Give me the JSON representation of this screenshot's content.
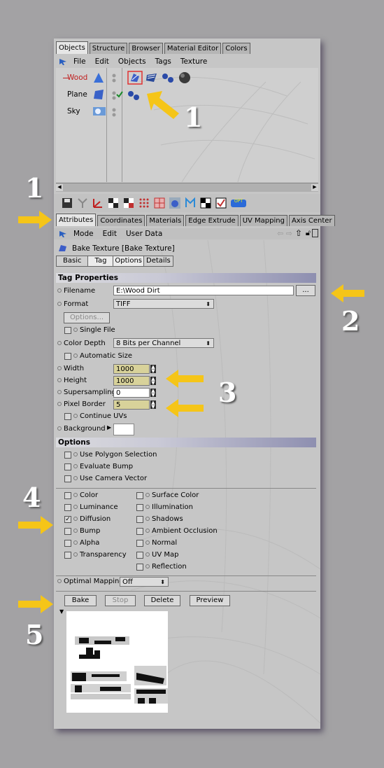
{
  "top_tabs": [
    "Objects",
    "Structure",
    "Browser",
    "Material Editor",
    "Colors"
  ],
  "top_menu": [
    "File",
    "Edit",
    "Objects",
    "Tags",
    "Texture"
  ],
  "objects": [
    {
      "name": "Wood",
      "highlight": true
    },
    {
      "name": "Plane",
      "highlight": false
    },
    {
      "name": "Sky",
      "highlight": false
    }
  ],
  "attr_tabs": [
    "Attributes",
    "Coordinates",
    "Materials",
    "Edge Extrude",
    "UV Mapping",
    "Axis Center"
  ],
  "attr_menu": [
    "Mode",
    "Edit",
    "User Data"
  ],
  "tag_title": "Bake Texture [Bake Texture]",
  "sub_tabs": [
    "Basic",
    "Tag",
    "Options",
    "Details"
  ],
  "tag_properties": {
    "header": "Tag Properties",
    "filename_label": "Filename",
    "filename_value": "E:\\Wood Dirt",
    "browse_label": "...",
    "format_label": "Format",
    "format_value": "TIFF",
    "options_button": "Options...",
    "single_file": "Single File",
    "color_depth_label": "Color Depth",
    "color_depth_value": "8 Bits per Channel",
    "automatic_size": "Automatic Size",
    "width_label": "Width",
    "width_value": "1000",
    "height_label": "Height",
    "height_value": "1000",
    "supersampling_label": "Supersampling",
    "supersampling_value": "0",
    "pixel_border_label": "Pixel Border",
    "pixel_border_value": "5",
    "continue_uvs": "Continue UVs",
    "background_label": "Background",
    "background_color": "#ffffff"
  },
  "options": {
    "header": "Options",
    "checks": [
      "Use Polygon Selection",
      "Evaluate Bump",
      "Use Camera Vector"
    ]
  },
  "channels": {
    "left": [
      {
        "label": "Color",
        "checked": false
      },
      {
        "label": "Luminance",
        "checked": false
      },
      {
        "label": "Diffusion",
        "checked": true
      },
      {
        "label": "Bump",
        "checked": false
      },
      {
        "label": "Alpha",
        "checked": false
      },
      {
        "label": "Transparency",
        "checked": false
      }
    ],
    "right": [
      {
        "label": "Surface Color",
        "checked": false
      },
      {
        "label": "Illumination",
        "checked": false
      },
      {
        "label": "Shadows",
        "checked": false
      },
      {
        "label": "Ambient Occlusion",
        "checked": false
      },
      {
        "label": "Normal",
        "checked": false
      },
      {
        "label": "UV Map",
        "checked": false
      },
      {
        "label": "Reflection",
        "checked": false
      }
    ]
  },
  "optimal_mapping_label": "Optimal Mapping",
  "optimal_mapping_value": "Off",
  "buttons": {
    "bake": "Bake",
    "stop": "Stop",
    "delete": "Delete",
    "preview": "Preview"
  },
  "annotations": {
    "n1a": "1",
    "n1b": "1",
    "n2": "2",
    "n3": "3",
    "n4": "4",
    "n5": "5"
  },
  "colors": {
    "arrow": "#f5c518",
    "panel": "#c6c6c6",
    "header_gradient_end": "#8e8fb0",
    "numeric_field": "#d8d29a"
  }
}
